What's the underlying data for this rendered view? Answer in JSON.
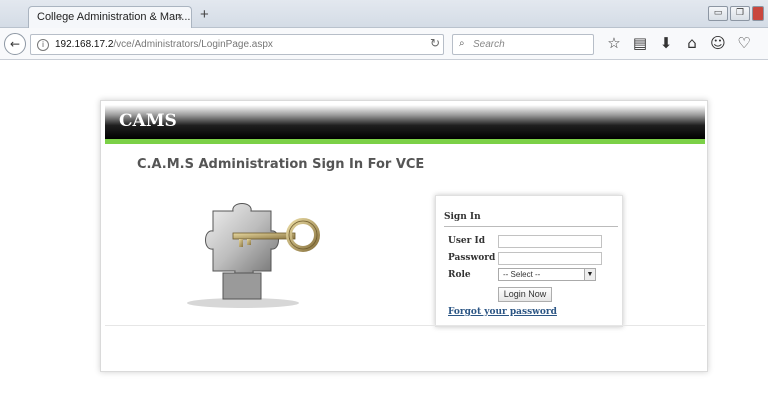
{
  "browser": {
    "tab_title": "College Administration & Man...",
    "tab_close": "×",
    "new_tab": "+",
    "url_host": "192.168.17.2",
    "url_path": "/vce/Administrators/LoginPage.aspx",
    "search_placeholder": "Search",
    "icons": [
      "star-icon",
      "bookmarks-icon",
      "download-icon",
      "home-icon",
      "chat-icon",
      "pocket-icon"
    ]
  },
  "page": {
    "brand": "CAMS",
    "title": "C.A.M.S Administration Sign In For VCE",
    "accent_color": "#7bd047"
  },
  "login": {
    "heading": "Sign In",
    "user_label": "User Id",
    "user_value": "",
    "password_label": "Password",
    "password_value": "",
    "role_label": "Role",
    "role_selected": "-- Select --",
    "submit_label": "Login Now",
    "forgot_label": "Forgot your password"
  }
}
